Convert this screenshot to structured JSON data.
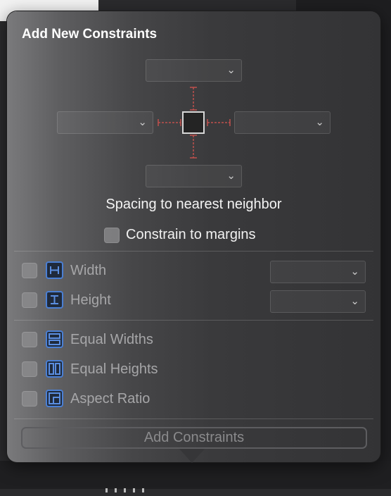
{
  "popover": {
    "title": "Add New Constraints",
    "spacing_label": "Spacing to nearest neighbor",
    "constrain_to_margins_label": "Constrain to margins",
    "constrain_to_margins_checked": false,
    "spacing_dropdowns": {
      "top": {
        "value": "",
        "icon": "chevron-down-icon"
      },
      "leading": {
        "value": "",
        "icon": "chevron-down-icon"
      },
      "trailing": {
        "value": "",
        "icon": "chevron-down-icon"
      },
      "bottom": {
        "value": "",
        "icon": "chevron-down-icon"
      }
    },
    "size_rows": [
      {
        "label": "Width",
        "checked": false,
        "icon": "width-constraint-icon",
        "value": ""
      },
      {
        "label": "Height",
        "checked": false,
        "icon": "height-constraint-icon",
        "value": ""
      }
    ],
    "equal_rows": [
      {
        "label": "Equal Widths",
        "checked": false,
        "icon": "equal-widths-icon"
      },
      {
        "label": "Equal Heights",
        "checked": false,
        "icon": "equal-heights-icon"
      },
      {
        "label": "Aspect Ratio",
        "checked": false,
        "icon": "aspect-ratio-icon"
      }
    ],
    "add_button_label": "Add Constraints",
    "add_button_enabled": false
  },
  "colors": {
    "strut": "#c0504d",
    "icon_blue": "#4a7fd4",
    "text_primary": "#ffffff",
    "text_disabled": "#a6a6a8"
  }
}
